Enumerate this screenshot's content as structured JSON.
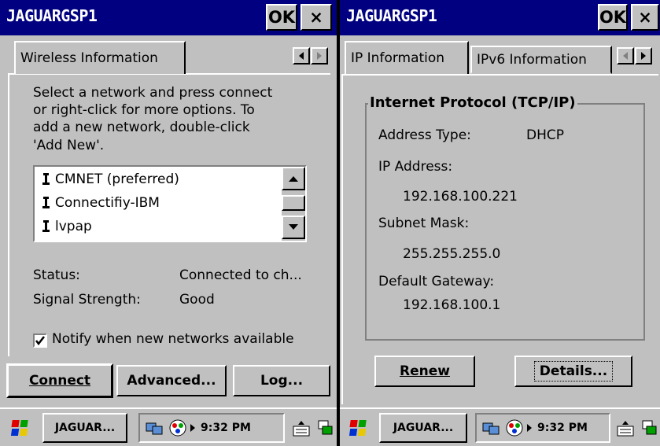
{
  "left": {
    "title": "JAGUARGSP1",
    "ok_label": "OK",
    "close_label": "×",
    "tab_label": "Wireless Information",
    "instruction_lines": [
      "Select a network and press connect",
      "or right-click for more options.  To",
      "add a new network, double-click",
      "'Add New'."
    ],
    "networks": [
      "CMNET (preferred)",
      "Connectifiy-IBM",
      "lvpap"
    ],
    "status_label": "Status:",
    "status_value": "Connected to ch...",
    "signal_label": "Signal Strength:",
    "signal_value": "Good",
    "notify_label": "Notify when new networks available",
    "notify_checked": true,
    "buttons": {
      "connect": "Connect",
      "advanced": "Advanced...",
      "log": "Log..."
    },
    "taskbar": {
      "app_label": "JAGUAR...",
      "time": "9:32 PM"
    }
  },
  "right": {
    "title": "JAGUARGSP1",
    "ok_label": "OK",
    "close_label": "×",
    "tabs": [
      "IP Information",
      "IPv6 Information"
    ],
    "group_title": "Internet Protocol (TCP/IP)",
    "address_type_label": "Address Type:",
    "address_type_value": "DHCP",
    "ip_label": "IP Address:",
    "ip_value": "192.168.100.221",
    "subnet_label": "Subnet Mask:",
    "subnet_value": "255.255.255.0",
    "gateway_label": "Default Gateway:",
    "gateway_value": "192.168.100.1",
    "buttons": {
      "renew": "Renew",
      "details": "Details..."
    },
    "taskbar": {
      "app_label": "JAGUAR...",
      "time": "9:32 PM"
    }
  },
  "colors": {
    "titlebar": "#000080",
    "face": "#c0c0c0",
    "desktop": "#000000"
  }
}
